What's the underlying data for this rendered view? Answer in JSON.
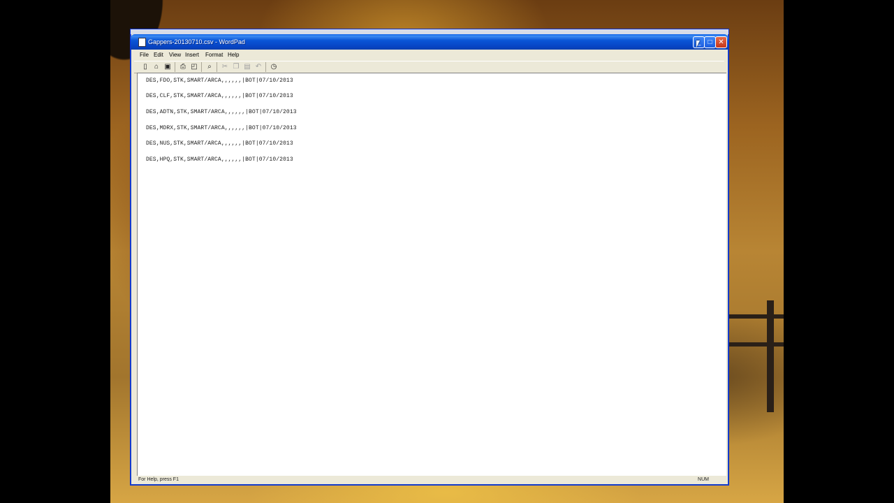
{
  "window": {
    "title": "Gappers-20130710.csv - WordPad",
    "minimize": "_",
    "maximize": "□",
    "close": "✕"
  },
  "menu": [
    "File",
    "Edit",
    "View",
    "Insert",
    "Format",
    "Help"
  ],
  "toolbar": {
    "icons": [
      "new-icon",
      "open-icon",
      "save-icon",
      "print-icon",
      "print-preview-icon",
      "find-icon",
      "cut-icon",
      "copy-icon",
      "paste-icon",
      "undo-icon",
      "datetime-icon"
    ]
  },
  "document": {
    "lines": [
      "DES,FDO,STK,SMART/ARCA,,,,,,|BOT|07/10/2013",
      "DES,CLF,STK,SMART/ARCA,,,,,,|BOT|07/10/2013",
      "DES,ADTN,STK,SMART/ARCA,,,,,,|BOT|07/10/2013",
      "DES,MDRX,STK,SMART/ARCA,,,,,,|BOT|07/10/2013",
      "DES,NUS,STK,SMART/ARCA,,,,,,|BOT|07/10/2013",
      "DES,HPQ,STK,SMART/ARCA,,,,,,|BOT|07/10/2013"
    ]
  },
  "status": {
    "help": "For Help, press F1",
    "num": "NUM"
  }
}
